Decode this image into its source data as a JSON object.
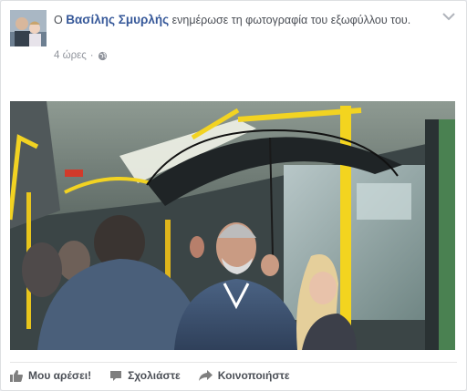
{
  "post": {
    "lead": "Ο",
    "author": "Βασίλης Σμυρλής",
    "action": "ενημέρωσε τη φωτογραφία του εξωφύλλου του.",
    "timestamp": "4 ώρες",
    "dot": "·",
    "privacy_icon": "globe-icon",
    "menu_icon": "chevron-down-icon"
  },
  "actions": {
    "like": "Μου αρέσει!",
    "comment": "Σχολιάστε",
    "share": "Κοινοποιήστε"
  },
  "colors": {
    "name": "#365899",
    "text": "#4b4f56",
    "muted": "#90949c",
    "handrail": "#f0d020"
  }
}
